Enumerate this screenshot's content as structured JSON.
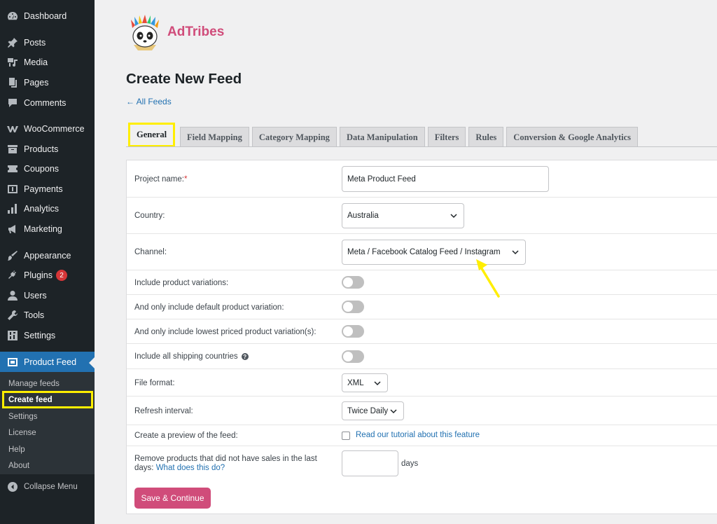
{
  "sidebar": {
    "items": [
      {
        "label": "Dashboard",
        "icon": "dashboard-icon"
      },
      {
        "label": "Posts",
        "icon": "pin-icon"
      },
      {
        "label": "Media",
        "icon": "media-icon"
      },
      {
        "label": "Pages",
        "icon": "pages-icon"
      },
      {
        "label": "Comments",
        "icon": "comment-icon"
      },
      {
        "label": "WooCommerce",
        "icon": "woocommerce-icon"
      },
      {
        "label": "Products",
        "icon": "archive-icon"
      },
      {
        "label": "Coupons",
        "icon": "ticket-icon"
      },
      {
        "label": "Payments",
        "icon": "payments-icon"
      },
      {
        "label": "Analytics",
        "icon": "bar-chart-icon"
      },
      {
        "label": "Marketing",
        "icon": "megaphone-icon"
      },
      {
        "label": "Appearance",
        "icon": "brush-icon"
      },
      {
        "label": "Plugins",
        "icon": "plug-icon",
        "badge": "2"
      },
      {
        "label": "Users",
        "icon": "user-icon"
      },
      {
        "label": "Tools",
        "icon": "wrench-icon"
      },
      {
        "label": "Settings",
        "icon": "settings-icon"
      },
      {
        "label": "Product Feed",
        "icon": "product-feed-icon"
      }
    ],
    "submenu": [
      "Manage feeds",
      "Create feed",
      "Settings",
      "License",
      "Help",
      "About"
    ],
    "collapse_label": "Collapse Menu"
  },
  "brand": {
    "name": "AdTribes"
  },
  "page": {
    "title": "Create New Feed",
    "back_link": "← All Feeds"
  },
  "tabs": [
    "General",
    "Field Mapping",
    "Category Mapping",
    "Data Manipulation",
    "Filters",
    "Rules",
    "Conversion & Google Analytics"
  ],
  "form": {
    "project_name": {
      "label": "Project name:",
      "required_mark": "*",
      "value": "Meta Product Feed"
    },
    "country": {
      "label": "Country:",
      "value": "Australia"
    },
    "channel": {
      "label": "Channel:",
      "value": "Meta / Facebook Catalog Feed / Instagram"
    },
    "variations": {
      "label": "Include product variations:"
    },
    "default_variation": {
      "label": "And only include default product variation:"
    },
    "lowest_variation": {
      "label": "And only include lowest priced product variation(s):"
    },
    "shipping_countries": {
      "label": "Include all shipping countries",
      "help": "?"
    },
    "file_format": {
      "label": "File format:",
      "value": "XML"
    },
    "refresh": {
      "label": "Refresh interval:",
      "value": "Twice Daily"
    },
    "preview": {
      "label": "Create a preview of the feed:",
      "link": "Read our tutorial about this feature"
    },
    "remove_products": {
      "label": "Remove products that did not have sales in the last days:",
      "link": "What does this do?",
      "value": "",
      "suffix": "days"
    },
    "save_button": "Save & Continue"
  },
  "colors": {
    "accent": "#2271b1",
    "brand": "#d04c7a",
    "highlight": "#ffee00"
  }
}
